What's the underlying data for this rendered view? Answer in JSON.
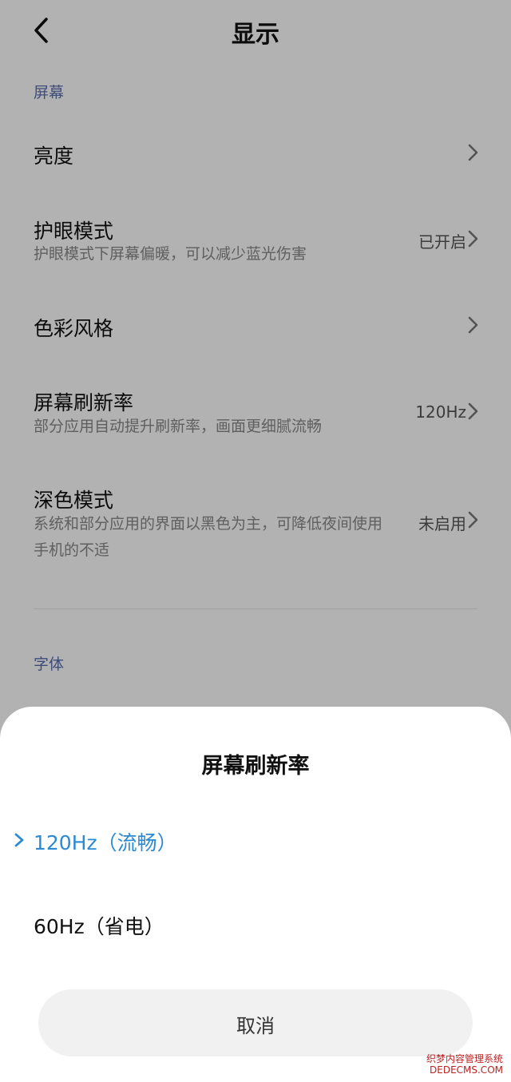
{
  "header": {
    "title": "显示"
  },
  "sections": {
    "screen": "屏幕",
    "font": "字体"
  },
  "items": {
    "brightness": {
      "title": "亮度"
    },
    "eye_care": {
      "title": "护眼模式",
      "subtitle": "护眼模式下屏幕偏暖，可以减少蓝光伤害",
      "value": "已开启"
    },
    "color_style": {
      "title": "色彩风格"
    },
    "refresh_rate": {
      "title": "屏幕刷新率",
      "subtitle": "部分应用自动提升刷新率，画面更细腻流畅",
      "value": "120Hz"
    },
    "dark_mode": {
      "title": "深色模式",
      "subtitle": "系统和部分应用的界面以黑色为主，可降低夜间使用手机的不适",
      "value": "未启用"
    }
  },
  "sheet": {
    "title": "屏幕刷新率",
    "options": [
      {
        "label": "120Hz（流畅）",
        "selected": true
      },
      {
        "label": "60Hz（省电）",
        "selected": false
      }
    ],
    "cancel_label": "取消"
  },
  "watermark": {
    "line1": "织梦内容管理系统",
    "line2": "DEDECMS.COM"
  },
  "colors": {
    "accent": "#2a8ad4",
    "section_label": "#5c6fb0",
    "overlay": "rgba(0,0,0,0.30)"
  }
}
